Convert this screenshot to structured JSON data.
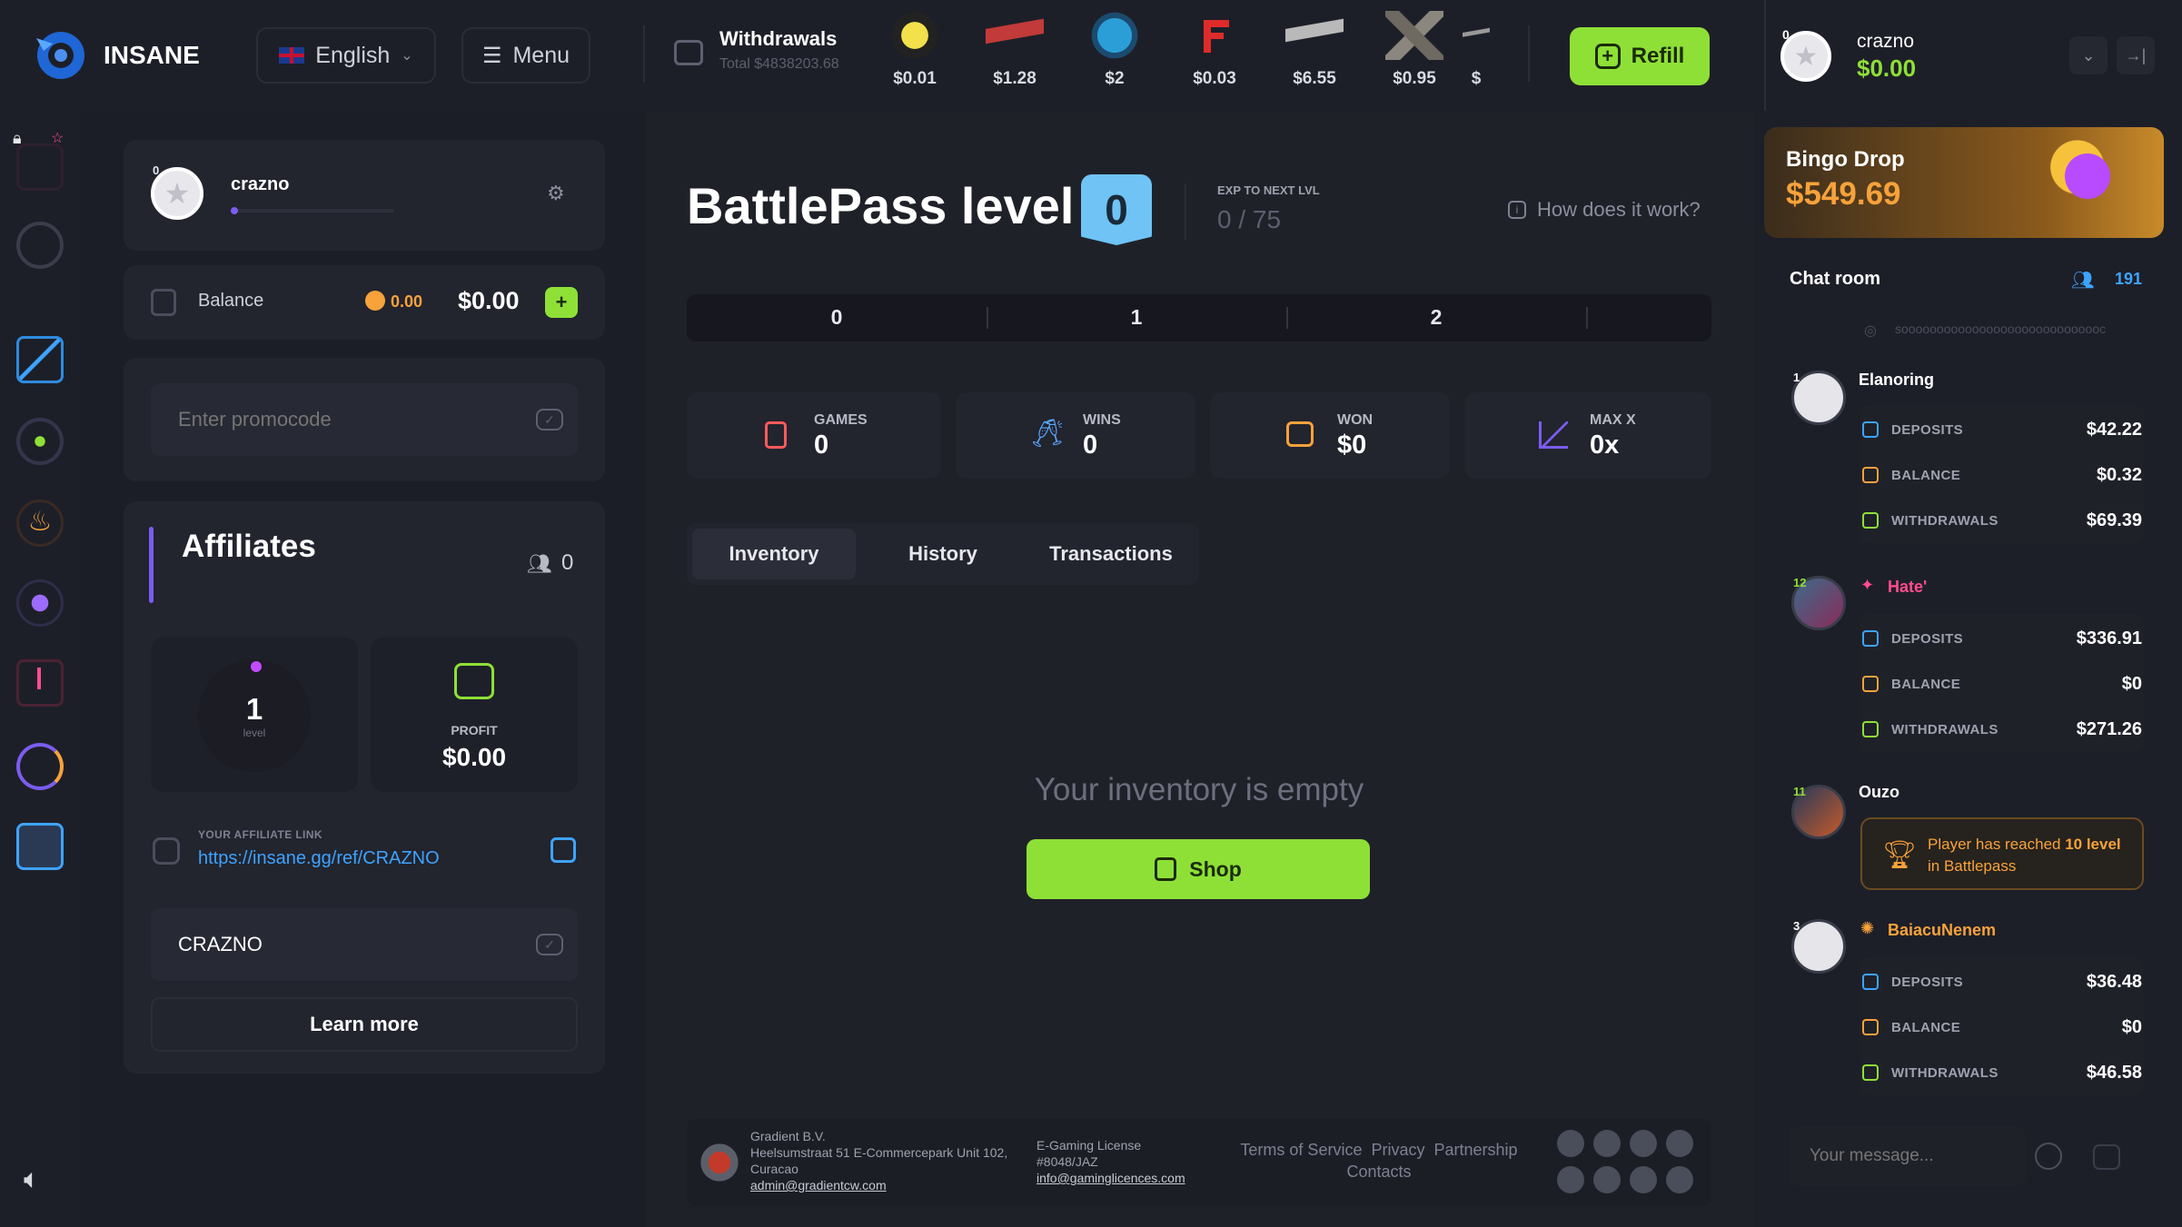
{
  "brand": {
    "name": "INSANE"
  },
  "header": {
    "language": "English",
    "menu_label": "Menu",
    "withdrawals_title": "Withdrawals",
    "withdrawals_total": "Total $4838203.68",
    "withdrawal_prices": [
      "$0.01",
      "$1.28",
      "$2",
      "$0.03",
      "$6.55",
      "$0.95",
      "$"
    ],
    "refill_label": "Refill",
    "user_name": "crazno",
    "user_balance": "$0.00"
  },
  "profile": {
    "username": "crazno",
    "balance_label": "Balance",
    "coins": "0.00",
    "balance": "$0.00",
    "promo_placeholder": "Enter promocode"
  },
  "affiliates": {
    "title": "Affiliates",
    "referrals": "0",
    "level_value": "1",
    "level_label": "level",
    "profit_label": "PROFIT",
    "profit_value": "$0.00",
    "link_label": "YOUR AFFILIATE LINK",
    "link": "https://insane.gg/ref/CRAZNO",
    "code": "CRAZNO",
    "learn_more": "Learn more"
  },
  "battlepass": {
    "title": "BattlePass level",
    "level": "0",
    "exp_label": "EXP TO NEXT LVL",
    "exp_value": "0 / 75",
    "how_label": "How does it work?",
    "steps": [
      "0",
      "1",
      "2"
    ]
  },
  "stats": [
    {
      "label": "GAMES",
      "value": "0"
    },
    {
      "label": "WINS",
      "value": "0"
    },
    {
      "label": "WON",
      "value": "$0"
    },
    {
      "label": "MAX X",
      "value": "0x"
    }
  ],
  "tabs": [
    "Inventory",
    "History",
    "Transactions"
  ],
  "inventory": {
    "empty_text": "Your inventory is empty",
    "shop_label": "Shop"
  },
  "footer": {
    "company": "Gradient B.V.",
    "address1": "Heelsumstraat 51 E-Commercepark Unit 102,",
    "address2": "Curacao",
    "email": "admin@gradientcw.com",
    "license1": "E-Gaming License",
    "license2": "#8048/JAZ",
    "license_email": "info@gaminglicences.com",
    "links": [
      "Terms of Service",
      "Privacy",
      "Partnership",
      "Contacts"
    ]
  },
  "bingo": {
    "title": "Bingo Drop",
    "amount": "$549.69"
  },
  "chat": {
    "title": "Chat room",
    "online": "191",
    "ticker": "sooooooooooooooooooooooooooooc",
    "message_placeholder": "Your message...",
    "stat_labels": {
      "deposits": "DEPOSITS",
      "balance": "BALANCE",
      "withdrawals": "WITHDRAWALS"
    },
    "users": [
      {
        "name": "Elanoring",
        "level": "1",
        "deposits": "$42.22",
        "balance": "$0.32",
        "withdrawals": "$69.39"
      },
      {
        "name": "Hate'",
        "level": "12",
        "deposits": "$336.91",
        "balance": "$0",
        "withdrawals": "$271.26"
      },
      {
        "name": "Ouzo",
        "level": "11"
      },
      {
        "name": "BaiacuNenem",
        "level": "3",
        "deposits": "$36.48",
        "balance": "$0",
        "withdrawals": "$46.58"
      }
    ],
    "notice_pre": "Player has reached ",
    "notice_level": "10 level",
    "notice_post": " in Battlepass"
  },
  "colors": {
    "accent_green": "#8ee037",
    "bp_blue": "#6fc3f5",
    "orange": "#f7a23b",
    "pink": "#ff4d8d",
    "purple": "#7b5cf0"
  }
}
